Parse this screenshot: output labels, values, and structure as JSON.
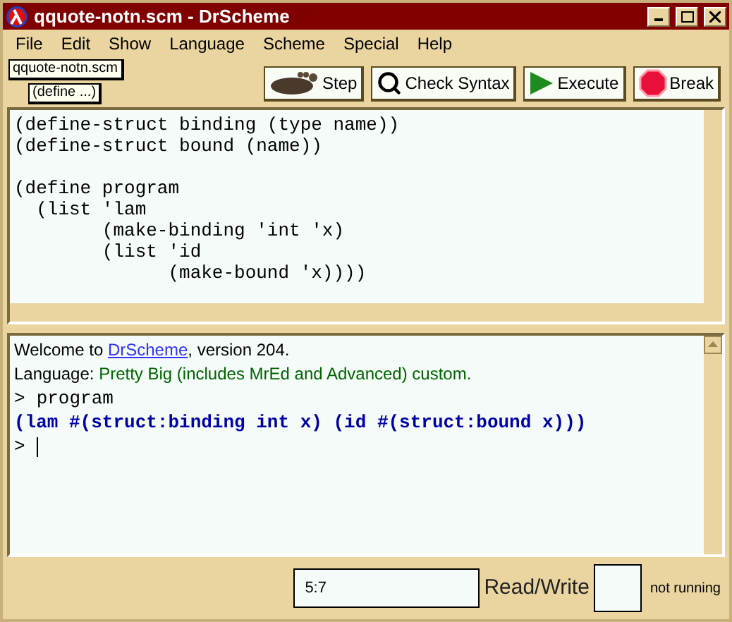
{
  "window": {
    "title": "qquote-notn.scm - DrScheme"
  },
  "menu": [
    "File",
    "Edit",
    "Show",
    "Language",
    "Scheme",
    "Special",
    "Help"
  ],
  "file_tab": "qquote-notn.scm",
  "define_menu": "(define ...)",
  "toolbar": [
    {
      "kind": "step",
      "label": "Step"
    },
    {
      "kind": "check",
      "label": "Check Syntax"
    },
    {
      "kind": "execute",
      "label": "Execute"
    },
    {
      "kind": "break",
      "label": "Break"
    }
  ],
  "editor": {
    "blocks": [
      [
        "(define-struct binding (type name))",
        "(define-struct bound (name))"
      ],
      [
        "(define program",
        "  (list 'lam",
        "        (make-binding 'int 'x)",
        "        (list 'id",
        "              (make-bound 'x))))"
      ]
    ]
  },
  "interactions": {
    "lines": [
      {
        "kind": "welcome",
        "before": "Welcome to ",
        "link": "DrScheme",
        "after": ", version 204."
      },
      {
        "kind": "language",
        "label": "Language: ",
        "value": "Pretty Big (includes MrEd and Advanced) custom."
      },
      {
        "kind": "input",
        "prompt": ">",
        "text": "program"
      },
      {
        "kind": "output",
        "text": "(lam #(struct:binding int x) (id #(struct:bound x)))"
      },
      {
        "kind": "prompt",
        "prompt": ">"
      }
    ]
  },
  "status": {
    "position": "5:7",
    "mode": "Read/Write",
    "running": "not running"
  }
}
